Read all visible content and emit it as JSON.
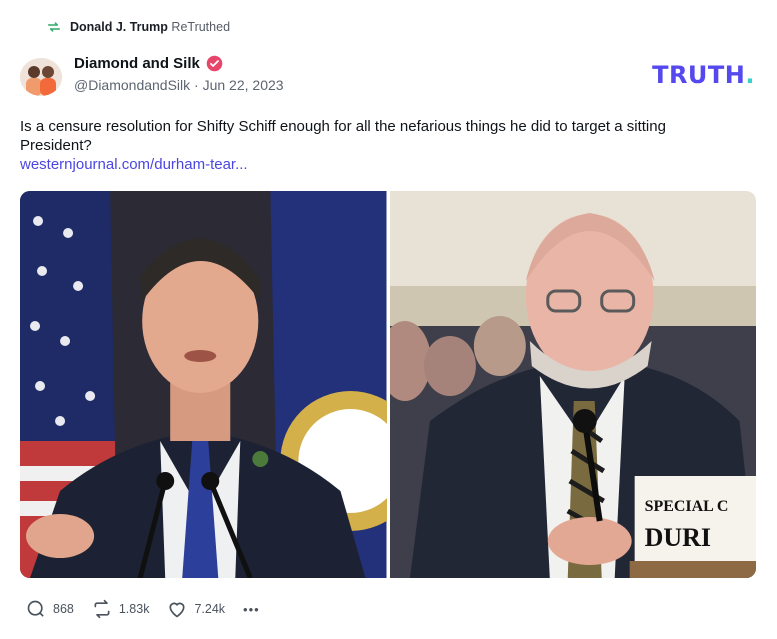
{
  "retruth": {
    "user": "Donald J. Trump",
    "label": "ReTruthed",
    "icon": "retruth-icon"
  },
  "post": {
    "author": {
      "name": "Diamond and Silk",
      "handle_date": "@DiamondandSilk · Jun 22, 2023",
      "verified_icon": "verified-badge-icon"
    },
    "text": "Is a censure resolution for Shifty Schiff enough for all the nefarious things he did to target a sitting President?",
    "link": "westernjournal.com/durham-tear...",
    "media_left_icon": "photo-man-at-podium",
    "media_right_icon": "photo-man-at-hearing",
    "media_right_placard": [
      "SPECIAL C",
      "DURI"
    ]
  },
  "brand": {
    "text": "TRUTH",
    "dot": ".",
    "color": "#5448ee",
    "dot_color": "#3ad1c8"
  },
  "actions": {
    "replies": "868",
    "retruths": "1.83k",
    "likes": "7.24k",
    "more": "•••"
  }
}
